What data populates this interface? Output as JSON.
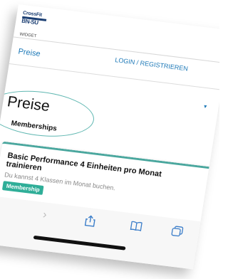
{
  "header": {
    "logo_top": "CrossFit",
    "logo_bottom": "BN-SU",
    "widget_label": "WIDGET"
  },
  "nav": {
    "preise": "Preise",
    "login": "LOGIN / REGISTRIEREN"
  },
  "main": {
    "title": "Preise",
    "section": "Memberships",
    "card": {
      "title": "Basic Performance 4 Einheiten pro Monat trainieren",
      "subtitle": "Du kannst 4 Klassen im Monat buchen.",
      "badge": "Membership"
    }
  },
  "toolbar": {
    "back": "back-arrow-icon",
    "forward": "forward-arrow-icon",
    "share": "share-icon",
    "bookmarks": "book-icon",
    "tabs": "tabs-icon"
  },
  "colors": {
    "accent": "#1f7ab8",
    "teal": "#4aa79e",
    "badge": "#2fae98",
    "logo": "#1c3f73"
  }
}
